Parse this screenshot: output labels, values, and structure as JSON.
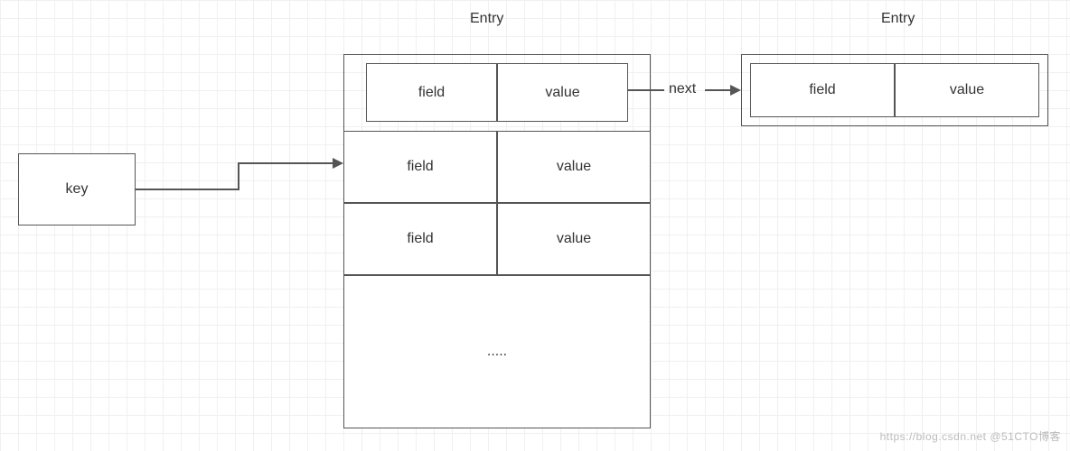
{
  "key_box": {
    "label": "key"
  },
  "entry1": {
    "title": "Entry",
    "rows": [
      {
        "field": "field",
        "value": "value"
      },
      {
        "field": "field",
        "value": "value"
      },
      {
        "field": "field",
        "value": "value"
      }
    ],
    "ellipsis": "....."
  },
  "next_label": "next",
  "entry2": {
    "title": "Entry",
    "row": {
      "field": "field",
      "value": "value"
    }
  },
  "watermark": "https://blog.csdn.net @51CTO博客"
}
